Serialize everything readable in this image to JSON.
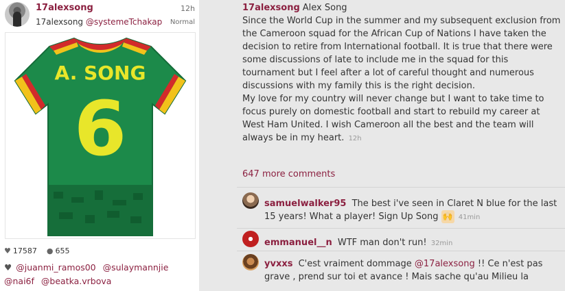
{
  "post": {
    "username": "17alexsong",
    "time": "12h",
    "author_short": "17alexsong",
    "tagged_user": "@systemeTchakap",
    "filter": "Normal",
    "jersey": {
      "name": "A. SONG",
      "number": "6"
    },
    "likes": "17587",
    "comments_count": "655",
    "likers": [
      "@juanmi_ramos00",
      "@sulaymannjie",
      "@nai6f",
      "@beatka.vrbova"
    ]
  },
  "caption": {
    "username": "17alexsong",
    "display_name": "Alex Song",
    "paragraph1": "Since the World Cup in the summer and my subsequent exclusion from the Cameroon squad for the African Cup of Nations I have taken the decision to retire from International football. It is true that there were some discussions of late to include me in the squad for this tournament but I feel after a lot of careful thought and numerous discussions with my family this is the right decision.",
    "paragraph2": "My love for my country will never change but I want to take time to focus purely on domestic football and start to rebuild my career at West Ham United. I wish Cameroon all the best and the team will always be in my heart.",
    "time": "12h"
  },
  "more_comments": "647 more comments",
  "comments": [
    {
      "user": "samuelwalker95",
      "text": "The best i've seen in Claret N blue for the last 15 years! What a player! Sign Up Song",
      "emoji": "🙌",
      "time": "41min"
    },
    {
      "user": "emmanuel__n",
      "text": "WTF man don't run!",
      "time": "32min"
    },
    {
      "user": "yvxxs",
      "text_before": "C'est vraiment dommage",
      "mention": "@17alexsong",
      "text_after": "!! Ce n'est pas grave , prend sur toi et avance ! Mais sache qu'au Milieu la"
    }
  ]
}
